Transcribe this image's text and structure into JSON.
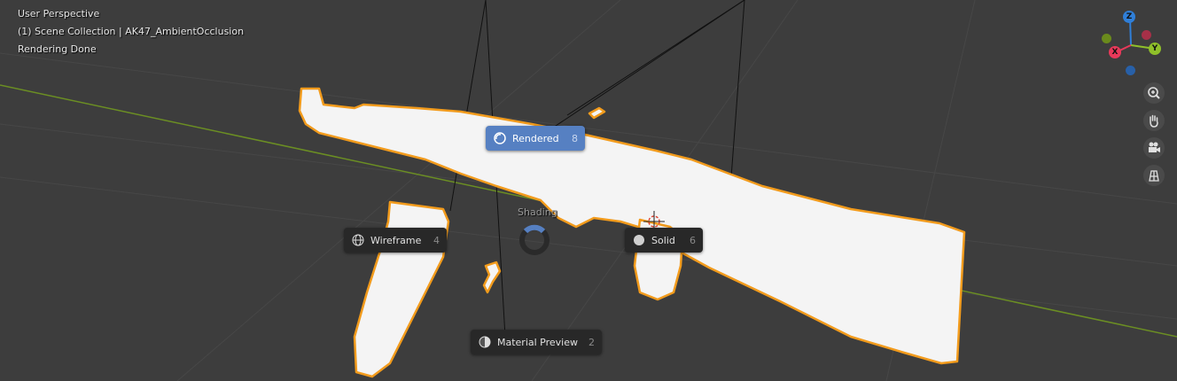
{
  "overlay": {
    "view": "User Perspective",
    "collection": "(1) Scene Collection | AK47_AmbientOcclusion",
    "status": "Rendering Done"
  },
  "pie_menu": {
    "title": "Shading",
    "items": [
      {
        "label": "Rendered",
        "key": "8",
        "icon": "rendered-icon",
        "active": true
      },
      {
        "label": "Wireframe",
        "key": "4",
        "icon": "wireframe-icon",
        "active": false
      },
      {
        "label": "Solid",
        "key": "6",
        "icon": "solid-icon",
        "active": false
      },
      {
        "label": "Material Preview",
        "key": "2",
        "icon": "material-preview-icon",
        "active": false
      }
    ]
  },
  "gizmo": {
    "axes": [
      {
        "label": "Z",
        "color": "#2f7fd9"
      },
      {
        "label": "Y",
        "color": "#8fc02a"
      },
      {
        "label": "X",
        "color": "#e8395a"
      }
    ]
  },
  "nav_buttons": [
    "zoom-icon",
    "hand-pan-icon",
    "camera-icon",
    "grid-ortho-icon"
  ],
  "colors": {
    "background": "#3d3d3d",
    "selection_outline": "#f29b1c",
    "pie_active": "#5680c2",
    "pie_bg": "#282828"
  }
}
